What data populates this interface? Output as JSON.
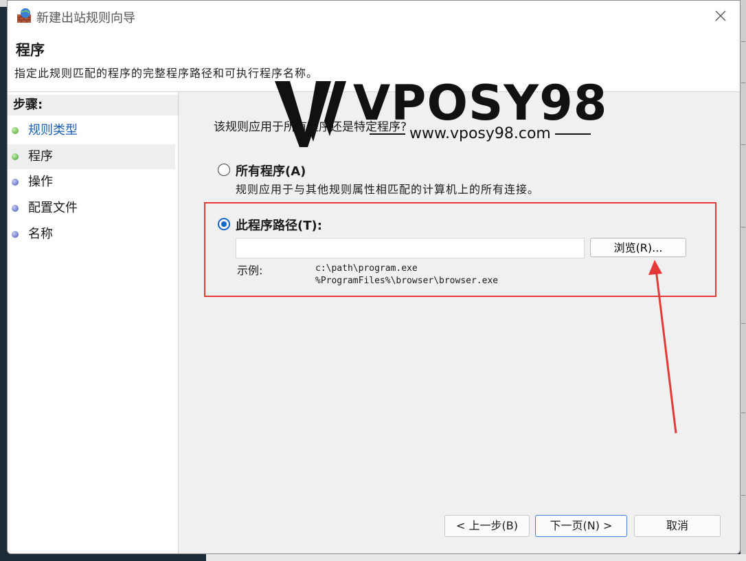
{
  "window": {
    "title": "新建出站规则向导"
  },
  "header": {
    "title": "程序",
    "description": "指定此规则匹配的程序的完整程序路径和可执行程序名称。"
  },
  "sidebar": {
    "title": "步骤:",
    "items": [
      {
        "label": "规则类型",
        "bullet": "green"
      },
      {
        "label": "程序",
        "bullet": "green"
      },
      {
        "label": "操作",
        "bullet": "blue"
      },
      {
        "label": "配置文件",
        "bullet": "blue"
      },
      {
        "label": "名称",
        "bullet": "blue"
      }
    ]
  },
  "main": {
    "question": "该规则应用于所有程序还是特定程序?",
    "option_all": {
      "label": "所有程序(A)",
      "description": "规则应用于与其他规则属性相匹配的计算机上的所有连接。"
    },
    "option_path": {
      "label": "此程序路径(T):",
      "input_value": "",
      "browse_label": "浏览(R)...",
      "example_label": "示例:",
      "example_lines": [
        "c:\\path\\program.exe",
        "%ProgramFiles%\\browser\\browser.exe"
      ]
    },
    "selected_option": "option_path"
  },
  "footer": {
    "back_label": "< 上一步(B)",
    "next_label": "下一页(N) >",
    "cancel_label": "取消"
  },
  "watermark": {
    "brand": "VPOSY98",
    "url": "www.vposy98.com"
  },
  "colors": {
    "accent": "#1065c4",
    "highlight": "#e53935",
    "link": "#1a5fb4"
  }
}
